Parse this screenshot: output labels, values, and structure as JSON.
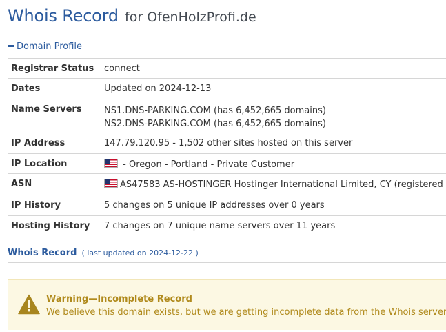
{
  "header": {
    "title": "Whois Record",
    "for_text": "for OfenHolzProfi.de"
  },
  "profile": {
    "section_label": "Domain Profile",
    "rows": [
      {
        "label": "Registrar Status",
        "value": "connect"
      },
      {
        "label": "Dates",
        "value": "Updated on 2024-12-13"
      },
      {
        "label": "Name Servers",
        "lines": [
          "NS1.DNS-PARKING.COM (has 6,452,665 domains)",
          "NS2.DNS-PARKING.COM (has 6,452,665 domains)"
        ]
      },
      {
        "label": "IP Address",
        "value": "147.79.120.95 - 1,502 other sites hosted on this server"
      },
      {
        "label": "IP Location",
        "value": " - Oregon - Portland - Private Customer",
        "icon": "us-flag-icon"
      },
      {
        "label": "ASN",
        "value": "AS47583 AS-HOSTINGER Hostinger International Limited, CY (registered",
        "icon": "us-flag-icon"
      },
      {
        "label": "IP History",
        "value": "5 changes on 5 unique IP addresses over 0 years"
      },
      {
        "label": "Hosting History",
        "value": "7 changes on 7 unique name servers over 11 years"
      }
    ]
  },
  "whois": {
    "title": "Whois Record",
    "subtitle": "( last updated on 2024-12-22 )"
  },
  "warning": {
    "title": "Warning—Incomplete Record",
    "text": "We believe this domain exists, but we are getting incomplete data from the Whois server.",
    "icon": "warning-triangle-icon",
    "color": "#b08a1c",
    "background": "#fcf8e3"
  },
  "colors": {
    "accent": "#2c5b9e",
    "text": "#333333",
    "rule": "#d6d6d6"
  }
}
